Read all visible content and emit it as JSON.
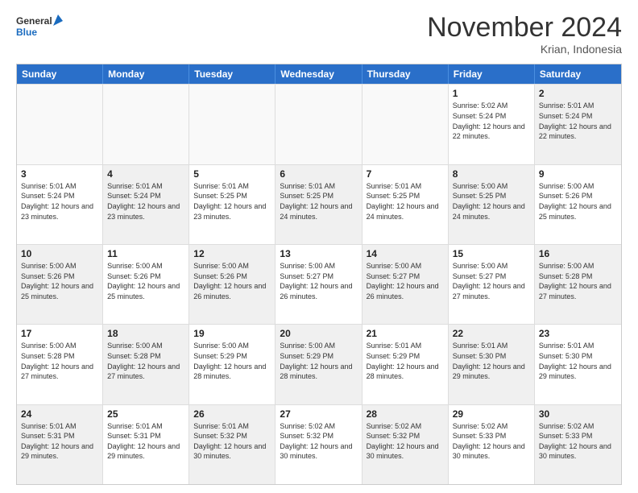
{
  "logo": {
    "general": "General",
    "blue": "Blue"
  },
  "title": "November 2024",
  "location": "Krian, Indonesia",
  "days": [
    "Sunday",
    "Monday",
    "Tuesday",
    "Wednesday",
    "Thursday",
    "Friday",
    "Saturday"
  ],
  "weeks": [
    [
      {
        "day": "",
        "empty": true
      },
      {
        "day": "",
        "empty": true
      },
      {
        "day": "",
        "empty": true
      },
      {
        "day": "",
        "empty": true
      },
      {
        "day": "",
        "empty": true
      },
      {
        "day": "1",
        "sunrise": "5:02 AM",
        "sunset": "5:24 PM",
        "daylight": "12 hours and 22 minutes."
      },
      {
        "day": "2",
        "sunrise": "5:01 AM",
        "sunset": "5:24 PM",
        "daylight": "12 hours and 22 minutes.",
        "shaded": true
      }
    ],
    [
      {
        "day": "3",
        "sunrise": "5:01 AM",
        "sunset": "5:24 PM",
        "daylight": "12 hours and 23 minutes."
      },
      {
        "day": "4",
        "sunrise": "5:01 AM",
        "sunset": "5:24 PM",
        "daylight": "12 hours and 23 minutes.",
        "shaded": true
      },
      {
        "day": "5",
        "sunrise": "5:01 AM",
        "sunset": "5:25 PM",
        "daylight": "12 hours and 23 minutes."
      },
      {
        "day": "6",
        "sunrise": "5:01 AM",
        "sunset": "5:25 PM",
        "daylight": "12 hours and 24 minutes.",
        "shaded": true
      },
      {
        "day": "7",
        "sunrise": "5:01 AM",
        "sunset": "5:25 PM",
        "daylight": "12 hours and 24 minutes."
      },
      {
        "day": "8",
        "sunrise": "5:00 AM",
        "sunset": "5:25 PM",
        "daylight": "12 hours and 24 minutes.",
        "shaded": true
      },
      {
        "day": "9",
        "sunrise": "5:00 AM",
        "sunset": "5:26 PM",
        "daylight": "12 hours and 25 minutes."
      }
    ],
    [
      {
        "day": "10",
        "sunrise": "5:00 AM",
        "sunset": "5:26 PM",
        "daylight": "12 hours and 25 minutes.",
        "shaded": true
      },
      {
        "day": "11",
        "sunrise": "5:00 AM",
        "sunset": "5:26 PM",
        "daylight": "12 hours and 25 minutes."
      },
      {
        "day": "12",
        "sunrise": "5:00 AM",
        "sunset": "5:26 PM",
        "daylight": "12 hours and 26 minutes.",
        "shaded": true
      },
      {
        "day": "13",
        "sunrise": "5:00 AM",
        "sunset": "5:27 PM",
        "daylight": "12 hours and 26 minutes."
      },
      {
        "day": "14",
        "sunrise": "5:00 AM",
        "sunset": "5:27 PM",
        "daylight": "12 hours and 26 minutes.",
        "shaded": true
      },
      {
        "day": "15",
        "sunrise": "5:00 AM",
        "sunset": "5:27 PM",
        "daylight": "12 hours and 27 minutes."
      },
      {
        "day": "16",
        "sunrise": "5:00 AM",
        "sunset": "5:28 PM",
        "daylight": "12 hours and 27 minutes.",
        "shaded": true
      }
    ],
    [
      {
        "day": "17",
        "sunrise": "5:00 AM",
        "sunset": "5:28 PM",
        "daylight": "12 hours and 27 minutes."
      },
      {
        "day": "18",
        "sunrise": "5:00 AM",
        "sunset": "5:28 PM",
        "daylight": "12 hours and 27 minutes.",
        "shaded": true
      },
      {
        "day": "19",
        "sunrise": "5:00 AM",
        "sunset": "5:29 PM",
        "daylight": "12 hours and 28 minutes."
      },
      {
        "day": "20",
        "sunrise": "5:00 AM",
        "sunset": "5:29 PM",
        "daylight": "12 hours and 28 minutes.",
        "shaded": true
      },
      {
        "day": "21",
        "sunrise": "5:01 AM",
        "sunset": "5:29 PM",
        "daylight": "12 hours and 28 minutes."
      },
      {
        "day": "22",
        "sunrise": "5:01 AM",
        "sunset": "5:30 PM",
        "daylight": "12 hours and 29 minutes.",
        "shaded": true
      },
      {
        "day": "23",
        "sunrise": "5:01 AM",
        "sunset": "5:30 PM",
        "daylight": "12 hours and 29 minutes."
      }
    ],
    [
      {
        "day": "24",
        "sunrise": "5:01 AM",
        "sunset": "5:31 PM",
        "daylight": "12 hours and 29 minutes.",
        "shaded": true
      },
      {
        "day": "25",
        "sunrise": "5:01 AM",
        "sunset": "5:31 PM",
        "daylight": "12 hours and 29 minutes."
      },
      {
        "day": "26",
        "sunrise": "5:01 AM",
        "sunset": "5:32 PM",
        "daylight": "12 hours and 30 minutes.",
        "shaded": true
      },
      {
        "day": "27",
        "sunrise": "5:02 AM",
        "sunset": "5:32 PM",
        "daylight": "12 hours and 30 minutes."
      },
      {
        "day": "28",
        "sunrise": "5:02 AM",
        "sunset": "5:32 PM",
        "daylight": "12 hours and 30 minutes.",
        "shaded": true
      },
      {
        "day": "29",
        "sunrise": "5:02 AM",
        "sunset": "5:33 PM",
        "daylight": "12 hours and 30 minutes."
      },
      {
        "day": "30",
        "sunrise": "5:02 AM",
        "sunset": "5:33 PM",
        "daylight": "12 hours and 30 minutes.",
        "shaded": true
      }
    ]
  ]
}
